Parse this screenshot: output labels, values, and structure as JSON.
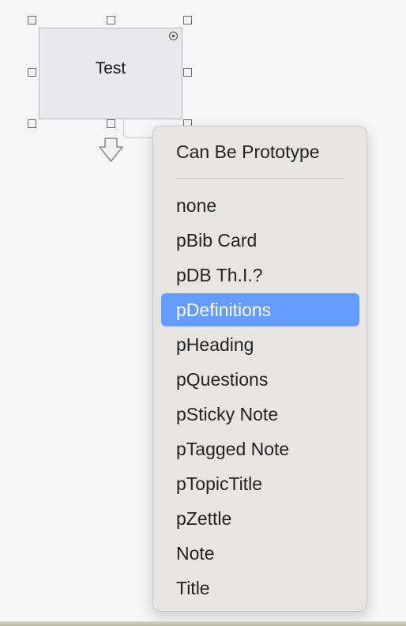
{
  "note": {
    "title": "Test"
  },
  "menu": {
    "header": "Can Be Prototype",
    "items": [
      {
        "label": "none",
        "selected": false
      },
      {
        "label": "pBib Card",
        "selected": false
      },
      {
        "label": "pDB Th.I.?",
        "selected": false
      },
      {
        "label": "pDefinitions",
        "selected": true
      },
      {
        "label": "pHeading",
        "selected": false
      },
      {
        "label": "pQuestions",
        "selected": false
      },
      {
        "label": "pSticky Note",
        "selected": false
      },
      {
        "label": "pTagged Note",
        "selected": false
      },
      {
        "label": "pTopicTitle",
        "selected": false
      },
      {
        "label": "pZettle",
        "selected": false
      },
      {
        "label": "Note",
        "selected": false
      },
      {
        "label": "Title",
        "selected": false
      }
    ]
  },
  "colors": {
    "selection": "#659bfb",
    "menu_background": "#e7e5e4",
    "note_background": "#e9e9ec"
  }
}
